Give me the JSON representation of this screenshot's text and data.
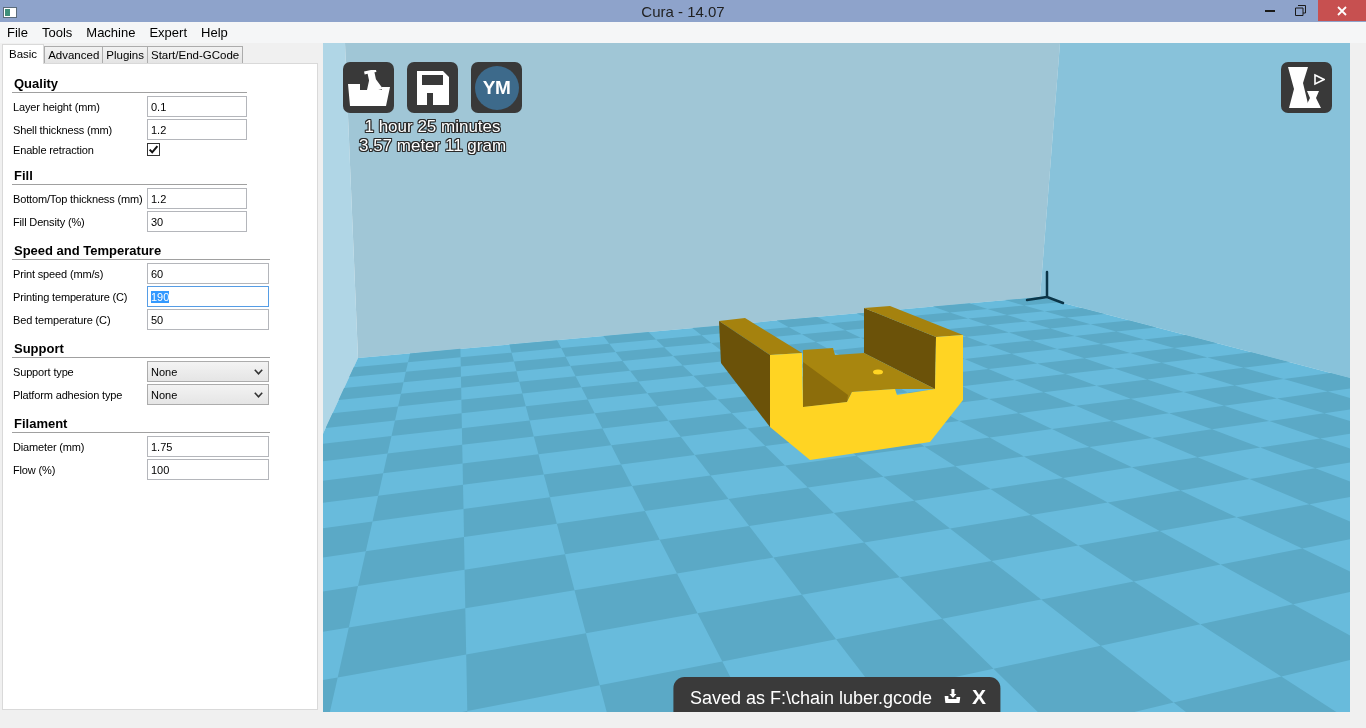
{
  "window": {
    "title": "Cura - 14.07"
  },
  "menu": [
    "File",
    "Tools",
    "Machine",
    "Expert",
    "Help"
  ],
  "tabs": [
    {
      "label": "Basic",
      "selected": true
    },
    {
      "label": "Advanced",
      "selected": false
    },
    {
      "label": "Plugins",
      "selected": false
    },
    {
      "label": "Start/End-GCode",
      "selected": false
    }
  ],
  "sections": [
    {
      "title": "Quality",
      "rows": [
        {
          "kind": "text",
          "label": "Layer height (mm)",
          "value": "0.1",
          "focused": false
        },
        {
          "kind": "text",
          "label": "Shell thickness (mm)",
          "value": "1.2",
          "focused": false
        },
        {
          "kind": "checkbox",
          "label": "Enable retraction",
          "checked": true,
          "focused": false
        }
      ]
    },
    {
      "title": "Fill",
      "rows": [
        {
          "kind": "text",
          "label": "Bottom/Top thickness (mm)",
          "value": "1.2",
          "focused": false
        },
        {
          "kind": "text",
          "label": "Fill Density (%)",
          "value": "30",
          "focused": false
        }
      ]
    },
    {
      "title": "Speed and Temperature",
      "rows": [
        {
          "kind": "text",
          "label": "Print speed (mm/s)",
          "value": "60",
          "focused": false
        },
        {
          "kind": "text",
          "label": "Printing temperature (C)",
          "value": "190",
          "focused": true
        },
        {
          "kind": "text",
          "label": "Bed temperature (C)",
          "value": "50",
          "focused": false
        }
      ]
    },
    {
      "title": "Support",
      "rows": [
        {
          "kind": "select",
          "label": "Support type",
          "value": "None",
          "focused": false
        },
        {
          "kind": "select",
          "label": "Platform adhesion type",
          "value": "None",
          "focused": false
        }
      ]
    },
    {
      "title": "Filament",
      "rows": [
        {
          "kind": "text",
          "label": "Diameter (mm)",
          "value": "1.75",
          "focused": false
        },
        {
          "kind": "text",
          "label": "Flow (%)",
          "value": "100",
          "focused": false
        }
      ]
    }
  ],
  "viewport": {
    "toolbar": [
      {
        "kind": "load"
      },
      {
        "kind": "save"
      },
      {
        "kind": "upload",
        "label": "YM"
      }
    ],
    "print_time": "1 hour 25 minutes",
    "filament_usage": "3.57 meter 11 gram"
  },
  "notification": {
    "message": "Saved as F:\\chain luber.gcode",
    "close_label": "X"
  }
}
